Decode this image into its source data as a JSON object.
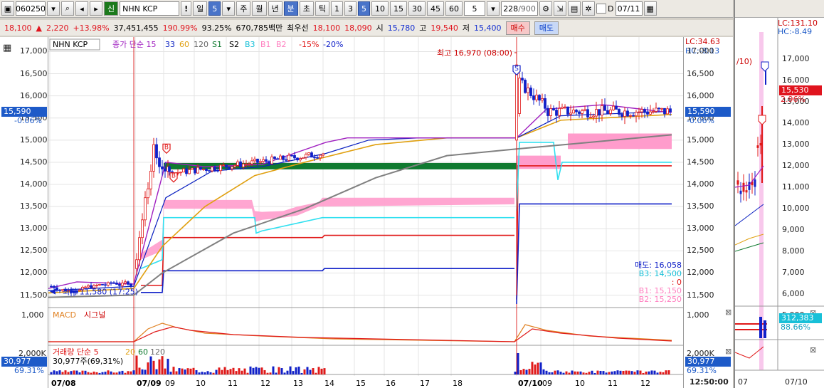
{
  "toolbar": {
    "code": "060250",
    "credit_badge": "신",
    "stock_name": "NHN KCP",
    "alert": "!",
    "period_day": "일",
    "period_num": "5",
    "tabs": [
      "주",
      "월",
      "년",
      "분",
      "초",
      "틱"
    ],
    "active_tab": "분",
    "intervals": [
      "1",
      "3",
      "5",
      "10",
      "15",
      "30",
      "45",
      "60"
    ],
    "active_interval": "5",
    "count_select": "5",
    "data_count": "228",
    "data_total": "/900",
    "checkbox_label": "D",
    "date": "07/11"
  },
  "info": {
    "price": "18,100",
    "change": "2,220",
    "change_pct": "+13.98%",
    "volume": "37,451,455",
    "vol_ratio": "190.99%",
    "ratio2": "93.25%",
    "amount": "670,785백만",
    "best_bid_label": "최우선",
    "best_ask": "18,100",
    "best_bid": "18,090",
    "open_label": "시",
    "open": "15,780",
    "high_label": "고",
    "high": "19,540",
    "low_label": "저",
    "low": "15,400",
    "buy_button": "매수",
    "sell_button": "매도"
  },
  "chart": {
    "legend": {
      "name": "NHN KCP",
      "close_ma": "종가 단순",
      "ma15": "15",
      "ma33": "33",
      "ma60": "60",
      "ma120": "120",
      "s1": "S1",
      "s2": "S2",
      "b3": "B3",
      "b1": "B1",
      "b2": "B2",
      "p15": "-15%",
      "p20": "-20%"
    },
    "high_annotation": "최고 16,970 (08:00)",
    "low_annotation": "최저 11,580 (17:25)",
    "lc": "LC:34.63",
    "hc": "HC:-8.13",
    "current_price": "15,590",
    "current_change": "-0.06%",
    "sell_label": "매도: 16,058",
    "b3_label": "B3: 14,500",
    "s_label": ": 0",
    "b1_label": "B1: 15,150",
    "b2_label": "B2: 15,250",
    "macd_label": "MACD",
    "signal_label": "시그널",
    "macd_value": "1,000",
    "volume_label": "거래량",
    "volume_ma": "단순 5",
    "vol_ma20": "20",
    "vol_ma60": "60",
    "vol_ma120": "120",
    "volume_value": "30,977주(69,31%)",
    "vol_axis_top": "2,000K",
    "vol_badge": "30,977",
    "vol_badge_pct": "69.31%",
    "time_label": "12:50:00",
    "price_ticks": [
      "17,000",
      "16,500",
      "16,000",
      "15,500",
      "15,000",
      "14,500",
      "14,000",
      "13,500",
      "13,000",
      "12,500",
      "12,000",
      "11,500"
    ],
    "x_labels": [
      "07/08",
      "07/09",
      "09",
      "10",
      "11",
      "12",
      "13",
      "14",
      "15",
      "16",
      "17",
      "18",
      "07/10",
      "09",
      "10",
      "11",
      "12"
    ]
  },
  "chart_data": {
    "type": "candlestick",
    "title": "NHN KCP",
    "series": [
      {
        "name": "종가 단순 15",
        "color": "#a020c0"
      },
      {
        "name": "33",
        "color": "#0a20c0"
      },
      {
        "name": "60",
        "color": "#e0a010"
      },
      {
        "name": "120",
        "color": "#808080"
      }
    ],
    "support_resistance": {
      "S1": 12800,
      "S2": 14420,
      "B3": 14500,
      "B1": 15150,
      "B2": 15250
    },
    "high": 16970,
    "low": 11580,
    "last": 15590,
    "ylim": [
      11300,
      17200
    ]
  },
  "rpanel": {
    "lc": "LC:131.10",
    "hc": "HC:-8.49",
    "date_partial": "/10)",
    "price_badge": "15,530",
    "pct_badge": "2.96%",
    "ticks": [
      "17,000",
      "16,000",
      "15,000",
      "14,000",
      "13,000",
      "12,000",
      "11,000",
      "10,000",
      "9,000",
      "8,000",
      "7,000",
      "6,000",
      "5,000"
    ],
    "macd_badge": "312,383",
    "macd_pct": "88.66%",
    "x_label": "07/10",
    "x_label_left": "07"
  }
}
